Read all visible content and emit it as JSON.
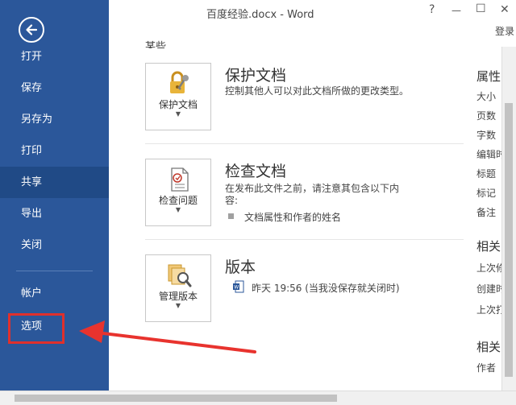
{
  "window": {
    "title": "百度经验.docx - Word",
    "help": "?",
    "minimize": "—",
    "restore": "☐",
    "close": "✕",
    "login": "登录"
  },
  "sidebar": {
    "items": [
      {
        "label": "打开"
      },
      {
        "label": "保存"
      },
      {
        "label": "另存为"
      },
      {
        "label": "打印"
      },
      {
        "label": "共享"
      },
      {
        "label": "导出"
      },
      {
        "label": "关闭"
      },
      {
        "label": "帐户"
      },
      {
        "label": "选项"
      }
    ],
    "active": "共享"
  },
  "main": {
    "cut_label": "某些",
    "protect": {
      "tile_label": "保护文档",
      "title": "保护文档",
      "desc": "控制其他人可以对此文档所做的更改类型。"
    },
    "inspect": {
      "tile_label": "检查问题",
      "title": "检查文档",
      "desc_line1": "在发布此文件之前，请注意其包含以下内",
      "desc_line2": "容:",
      "bullet": "文档属性和作者的姓名"
    },
    "versions": {
      "tile_label": "管理版本",
      "title": "版本",
      "entry": "昨天 19:56 (当我没保存就关闭时)"
    },
    "caret": "▼"
  },
  "properties": {
    "heading1": "属性",
    "items": [
      "大小",
      "页数",
      "字数",
      "编辑时",
      "标题",
      "标记",
      "备注"
    ],
    "heading2": "相关",
    "items2": [
      "上次修",
      "创建时",
      "上次打"
    ],
    "heading3": "相关",
    "items3": [
      "作者"
    ]
  },
  "colors": {
    "sidebar": "#2b579a",
    "sidebar_active": "#204a86",
    "highlight": "#e0302c"
  }
}
